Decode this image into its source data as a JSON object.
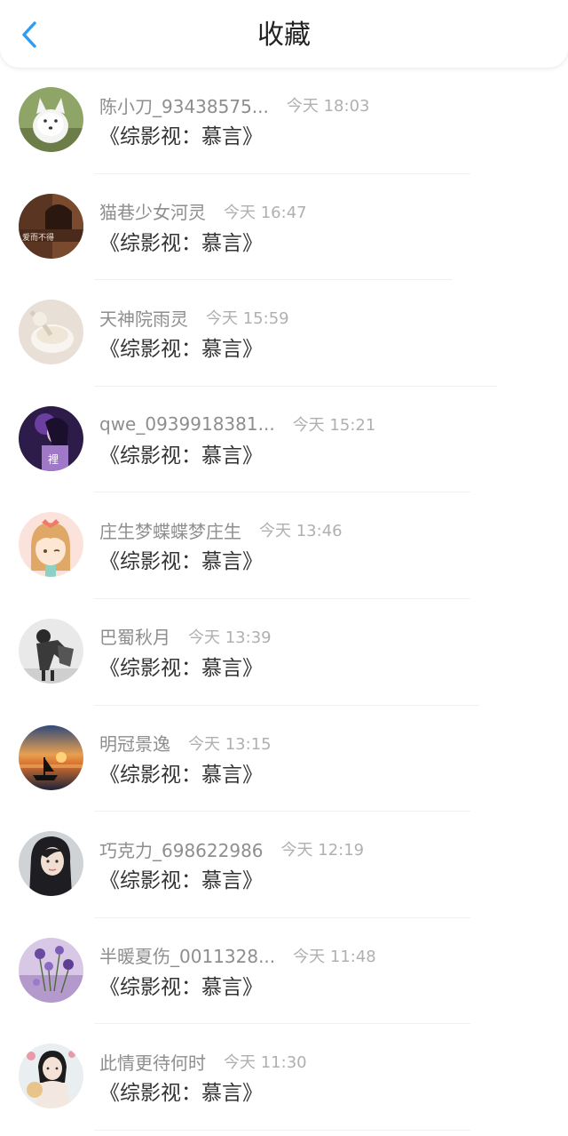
{
  "header": {
    "title": "收藏",
    "back_icon": "chevron-left-icon",
    "accent_color": "#2e9cf5"
  },
  "items": [
    {
      "username": "陈小刀_93438575...",
      "time": "今天 18:03",
      "title": "《综影视：慕言》"
    },
    {
      "username": "猫巷少女河灵",
      "time": "今天 16:47",
      "title": "《综影视：慕言》",
      "avatar_text": "爱而不得"
    },
    {
      "username": "天神院雨灵",
      "time": "今天 15:59",
      "title": "《综影视：慕言》"
    },
    {
      "username": "qwe_0939918381...",
      "time": "今天 15:21",
      "title": "《综影视：慕言》",
      "avatar_text": "裡"
    },
    {
      "username": "庄生梦蝶蝶梦庄生",
      "time": "今天 13:46",
      "title": "《综影视：慕言》"
    },
    {
      "username": "巴蜀秋月",
      "time": "今天 13:39",
      "title": "《综影视：慕言》"
    },
    {
      "username": "明冠景逸",
      "time": "今天 13:15",
      "title": "《综影视：慕言》"
    },
    {
      "username": "巧克力_698622986",
      "time": "今天 12:19",
      "title": "《综影视：慕言》"
    },
    {
      "username": "半暖夏伤_0011328...",
      "time": "今天 11:48",
      "title": "《综影视：慕言》"
    },
    {
      "username": "此情更待何时",
      "time": "今天 11:30",
      "title": "《综影视：慕言》"
    }
  ]
}
